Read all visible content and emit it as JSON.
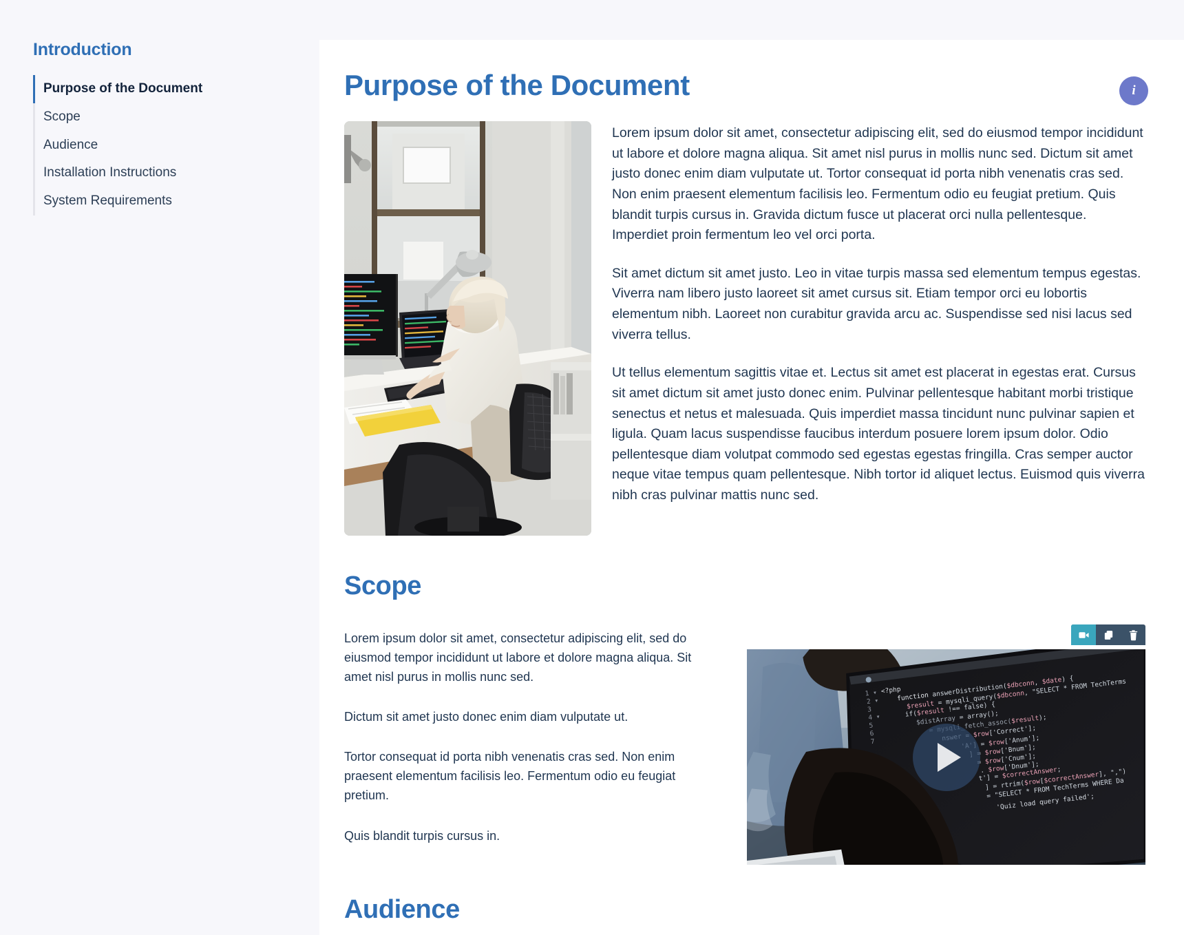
{
  "sidebar": {
    "title": "Introduction",
    "items": [
      {
        "label": "Purpose of the Document",
        "active": true
      },
      {
        "label": "Scope",
        "active": false
      },
      {
        "label": "Audience",
        "active": false
      },
      {
        "label": "Installation Instructions",
        "active": false
      },
      {
        "label": "System Requirements",
        "active": false
      }
    ]
  },
  "main": {
    "info_button_label": "i",
    "sections": {
      "purpose": {
        "heading": "Purpose of the Document",
        "image_alt": "Developer with blonde hair working at a desk with code on an iMac and a laptop beside an office window",
        "paragraphs": [
          "Lorem ipsum dolor sit amet, consectetur adipiscing elit, sed do eiusmod tempor incididunt ut labore et dolore magna aliqua. Sit amet nisl purus in mollis nunc sed. Dictum sit amet justo donec enim diam vulputate ut. Tortor consequat id porta nibh venenatis cras sed. Non enim praesent elementum facilisis leo. Fermentum odio eu feugiat pretium. Quis blandit turpis cursus in. Gravida dictum fusce ut placerat orci nulla pellentesque. Imperdiet proin fermentum leo vel orci porta.",
          "Sit amet dictum sit amet justo. Leo in vitae turpis massa sed elementum tempus egestas. Viverra nam libero justo laoreet sit amet cursus sit. Etiam tempor orci eu lobortis elementum nibh. Laoreet non curabitur gravida arcu ac. Suspendisse sed nisi lacus sed viverra tellus.",
          "Ut tellus elementum sagittis vitae et. Lectus sit amet est placerat in egestas erat. Cursus sit amet dictum sit amet justo donec enim. Pulvinar pellentesque habitant morbi tristique senectus et netus et malesuada. Quis imperdiet massa tincidunt nunc pulvinar sapien et ligula. Quam lacus suspendisse faucibus interdum posuere lorem ipsum dolor. Odio pellentesque diam volutpat commodo sed egestas egestas fringilla. Cras semper auctor neque vitae tempus quam pellentesque. Nibh tortor id aliquet lectus. Euismod quis viverra nibh cras pulvinar mattis nunc sed."
        ]
      },
      "scope": {
        "heading": "Scope",
        "paragraphs": [
          "Lorem ipsum dolor sit amet, consectetur adipiscing elit, sed do eiusmod tempor incididunt ut labore et dolore magna aliqua. Sit amet nisl purus in mollis nunc sed.",
          "Dictum sit amet justo donec enim diam vulputate ut.",
          "Tortor consequat id porta nibh venenatis cras sed. Non enim praesent elementum facilisis leo. Fermentum odio eu feugiat pretium.",
          "Quis blandit turpis cursus in."
        ],
        "video": {
          "alt": "Two developers reviewing PHP source code on a large monitor",
          "code_lines": [
            "1 ▾ <?php",
            "2 ▾     function answerDistribution($dbconn, $date) {",
            "3         $result = mysqli_query($dbconn, \"SELECT * FROM TechTerms",
            "4 ▾     if($result !== false) {",
            "5         $distArray = array();",
            "6         ... = mysqli_fetch_assoc($result);",
            "7         answer = $row['Correct'];",
            "        'A'] = $row['Anum'];",
            "          ] = $row['Bnum'];",
            "          = $row['Cnum'];",
            "          . $row['Dnum'];",
            "        t'] = $correctAnswer;",
            "          ] = rtrim($row[$correctAnswer];",
            "          = \"SELECT * FROM TechTerms WHERE Da",
            "          'Quiz load query failed';"
          ],
          "toolbar": [
            {
              "name": "video-icon",
              "label": "Video",
              "active": true
            },
            {
              "name": "duplicate-icon",
              "label": "Duplicate",
              "active": false
            },
            {
              "name": "trash-icon",
              "label": "Delete",
              "active": false
            }
          ]
        }
      },
      "audience": {
        "heading": "Audience"
      }
    }
  },
  "colors": {
    "accent_blue": "#2f6fb5",
    "info_purple": "#6d79ca",
    "toolbar_dark": "#3b5268",
    "toolbar_active": "#3aa6bd",
    "page_bg": "#f7f7fb",
    "panel_bg": "#ffffff",
    "text": "#1f3550"
  }
}
